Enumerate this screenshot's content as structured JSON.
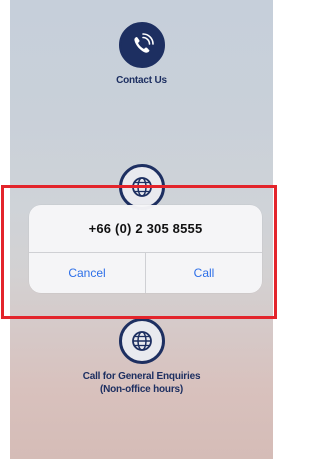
{
  "menu": {
    "contact": {
      "label": "Contact Us",
      "icon": "phone-call-icon"
    },
    "international": {
      "icon": "globe-phone-icon"
    },
    "general": {
      "label_line1": "Call for General Enquiries",
      "label_line2": "(Non-office hours)",
      "icon": "globe-phone-icon"
    }
  },
  "dialog": {
    "phone_number": "+66 (0) 2 305 8555",
    "cancel_label": "Cancel",
    "call_label": "Call"
  },
  "colors": {
    "brand_navy": "#1d2f61",
    "action_blue": "#2d6fe8",
    "highlight_red": "#e3242b"
  }
}
